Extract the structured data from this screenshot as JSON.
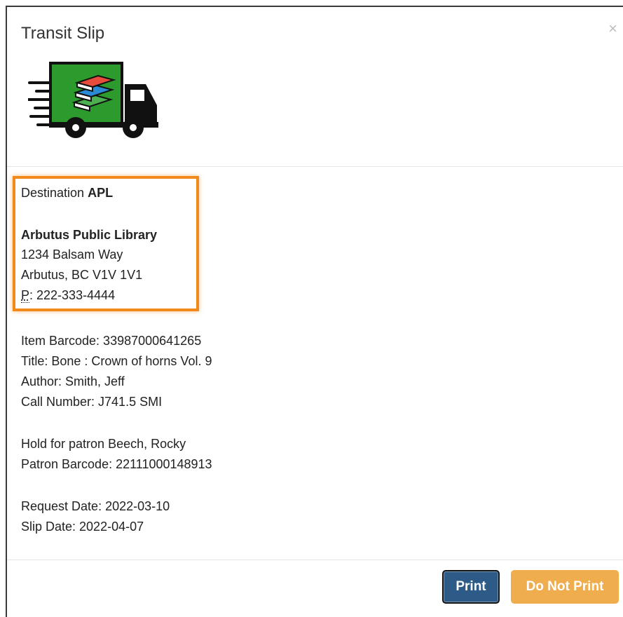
{
  "modal": {
    "title": "Transit Slip",
    "close_symbol": "×",
    "icon": "delivery-truck-books-icon"
  },
  "destination": {
    "label": "Destination",
    "code": "APL",
    "library_name": "Arbutus Public Library",
    "address_line1": "1234 Balsam Way",
    "address_line2": "Arbutus, BC V1V 1V1",
    "phone_abbr": "P",
    "phone_abbr_title": "Phone",
    "phone": ": 222-333-4444",
    "highlight_color": "#f28a1b"
  },
  "item": {
    "barcode": "Item Barcode: 33987000641265",
    "title": "Title: Bone : Crown of horns Vol. 9",
    "author": "Author: Smith, Jeff",
    "call_number": "Call Number:  J741.5 SMI"
  },
  "hold": {
    "patron": "Hold for patron Beech, Rocky",
    "patron_barcode": "Patron Barcode: 22111000148913"
  },
  "dates": {
    "request": "Request Date: 2022-03-10",
    "slip": "Slip Date: 2022-04-07"
  },
  "footer": {
    "print_label": "Print",
    "no_print_label": "Do Not Print",
    "print_color": "#2d5a86",
    "no_print_color": "#f0ad4e"
  }
}
